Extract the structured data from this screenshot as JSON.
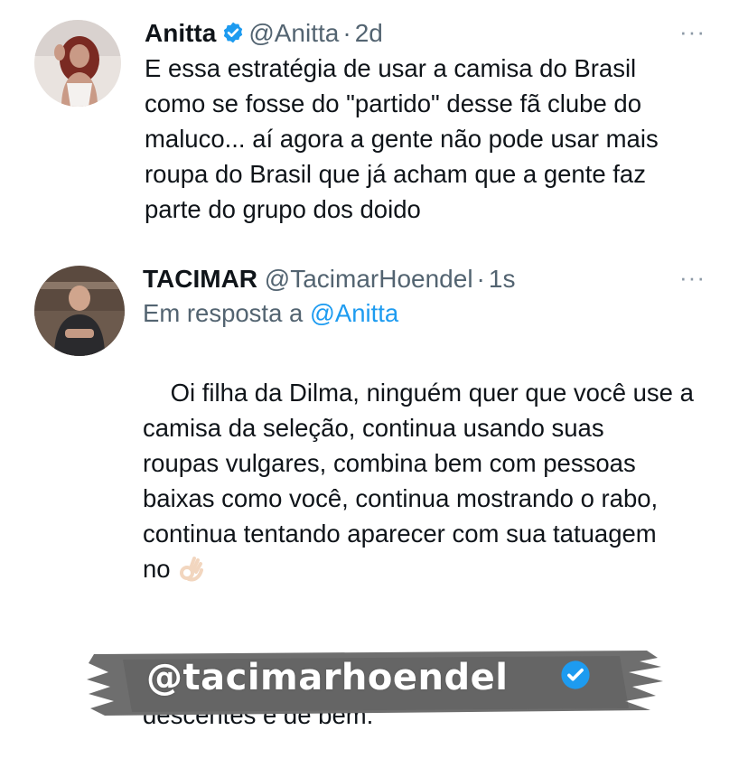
{
  "tweets": [
    {
      "name": "Anitta",
      "handle": "@Anitta",
      "separator": "·",
      "time": "2d",
      "more": "···",
      "text": "E essa estratégia de usar a camisa do Brasil\ncomo se fosse do \"partido\" desse fã clube do\nmaluco... aí agora a gente não pode usar mais\nroupa do Brasil que já acham que a gente faz\nparte do grupo dos doido"
    },
    {
      "name": "TACIMAR",
      "handle": "@TacimarHoendel",
      "separator": "·",
      "time": "1s",
      "more": "···",
      "reply_prefix": "Em resposta a",
      "reply_to": "@Anitta",
      "text_main": "Oi filha da Dilma, ninguém quer que você use a\ncamisa da seleção, continua usando suas\nroupas vulgares, combina bem com pessoas\nbaixas como você, continua mostrando o rabo,\ncontinua tentando aparecer com sua tatuagem\nno",
      "text_end": "Deixa a camisa da seleção pra pessoas\ndescentes e de bem.",
      "emoji": "ok-hand"
    }
  ],
  "banner": {
    "text": "@tacimarhoendel",
    "badge": "verified-badge"
  },
  "colors": {
    "verified": "#1d9bf0",
    "link": "#1d9bf0",
    "secondary": "#536471",
    "banner_gray": "#6e6e6e"
  }
}
